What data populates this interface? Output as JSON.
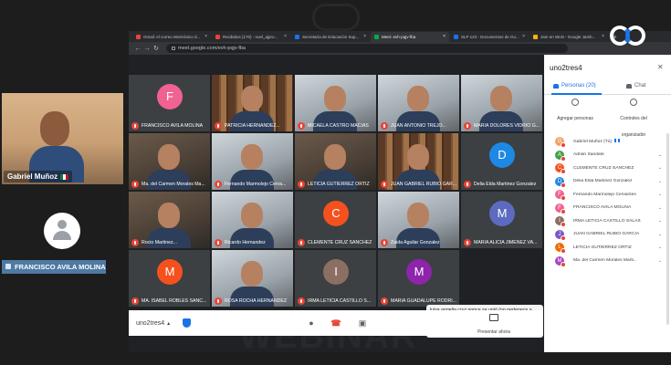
{
  "left": {
    "speaker_name": "Gabriel Muñoz",
    "side_name": "FRANCISCO AVILA MOLINA"
  },
  "tabs": [
    {
      "label": "Gmail: el correo electrónico d...",
      "color": "#ea4335"
    },
    {
      "label": "Recibidos (170) - noel_ajpro...",
      "color": "#ea4335"
    },
    {
      "label": "Secretaría de Educación Sup...",
      "color": "#1a73e8"
    },
    {
      "label": "Meet: evh-pqjv-fba",
      "color": "#00ac47"
    },
    {
      "label": "SLP 123 - Documentos de Go...",
      "color": "#1a73e8"
    },
    {
      "label": "Jam en WuN - Google Jamb...",
      "color": "#f4b400"
    }
  ],
  "address": {
    "url": "meet.google.com/evh-pqjv-fba"
  },
  "tiles": [
    {
      "name": "FRANCISCO AVILA MOLINA",
      "kind": "letter",
      "letter": "F",
      "color": "#f06292"
    },
    {
      "name": "PATRICIA HERNANDEZ...",
      "kind": "video",
      "variant": "shelf"
    },
    {
      "name": "MICAELA CASTRO MACIAS",
      "kind": "video",
      "variant": "light"
    },
    {
      "name": "JUAN ANTONIO TREJO...",
      "kind": "video",
      "variant": "light"
    },
    {
      "name": "MARIA DOLORES VIDRIO G...",
      "kind": "video",
      "variant": "light"
    },
    {
      "name": "Ma. del Carmen Morales Ma...",
      "kind": "video",
      "variant": ""
    },
    {
      "name": "Fernando Marmolejo Cerva...",
      "kind": "video",
      "variant": "light"
    },
    {
      "name": "LETICIA GUTIERREZ ORTIZ",
      "kind": "video",
      "variant": ""
    },
    {
      "name": "JUAN GABRIEL RUBIO GAR...",
      "kind": "video",
      "variant": "shelf"
    },
    {
      "name": "Delia Elda Martinez Gonzalez",
      "kind": "letter",
      "letter": "D",
      "color": "#1e88e5"
    },
    {
      "name": "Rocio Martinez...",
      "kind": "video",
      "variant": ""
    },
    {
      "name": "Ricardo Hernandez",
      "kind": "video",
      "variant": "light"
    },
    {
      "name": "CLEMENTE CRUZ SANCHEZ",
      "kind": "letter",
      "letter": "C",
      "color": "#f4511e"
    },
    {
      "name": "Zaida Aguilar Gonzalez",
      "kind": "video",
      "variant": "light"
    },
    {
      "name": "MARIA ALICIA JIMENEZ VA...",
      "kind": "letter",
      "letter": "M",
      "color": "#5c6bc0"
    },
    {
      "name": "MA. ISABEL ROBLES SANC...",
      "kind": "letter",
      "letter": "M",
      "color": "#f4511e"
    },
    {
      "name": "ROSA ROCHA HERNANDEZ",
      "kind": "video",
      "variant": "light"
    },
    {
      "name": "IRMA LETICIA CASTILLO S...",
      "kind": "letter",
      "letter": "I",
      "color": "#8d6e63"
    },
    {
      "name": "MARIA GUADALUPE RODRI...",
      "kind": "letter",
      "letter": "M",
      "color": "#8e24aa"
    }
  ],
  "chat_toast": {
    "message": "luisa angelia cruz ponce se unió (no pertenece a Secretaría de Educación San Luis Potosí)"
  },
  "bottom": {
    "meeting_code": "uno2tres4",
    "present_label": "Presentar ahora"
  },
  "panel": {
    "title": "uno2tres4",
    "people_tab": "Personas (20)",
    "chat_tab": "Chat",
    "add_people": "Agregar personas",
    "host_controls": "Controles del organizador",
    "participants": [
      {
        "name": "Gabriel Muñoz (Tú)",
        "letter": "G",
        "color": "#f4a261",
        "speaking": true
      },
      {
        "name": "Adrián Sandate",
        "letter": "A",
        "color": "#43a047",
        "speaking": false
      },
      {
        "name": "CLEMENTE CRUZ SANCHEZ",
        "letter": "C",
        "color": "#f4511e",
        "speaking": false
      },
      {
        "name": "Delia Elda Martinez Gonzalez",
        "letter": "D",
        "color": "#1e88e5",
        "speaking": false
      },
      {
        "name": "Fernando Marmolejo Cervantes",
        "letter": "F",
        "color": "#f06292",
        "speaking": false
      },
      {
        "name": "FRANCISCO AVILA MOLINA",
        "letter": "F",
        "color": "#f06292",
        "speaking": false
      },
      {
        "name": "IRMA LETICIA CASTILLO SALAS",
        "letter": "I",
        "color": "#8d6e63",
        "speaking": false
      },
      {
        "name": "JUAN GABRIEL RUBIO GARCIA",
        "letter": "J",
        "color": "#7e57c2",
        "speaking": false
      },
      {
        "name": "LETICIA GUTIERREZ ORTIZ",
        "letter": "L",
        "color": "#ef6c00",
        "speaking": false
      },
      {
        "name": "Ma. del Carmen Morales Marti...",
        "letter": "M",
        "color": "#ab47bc",
        "speaking": false
      }
    ]
  },
  "watermark": "WEBINAR"
}
